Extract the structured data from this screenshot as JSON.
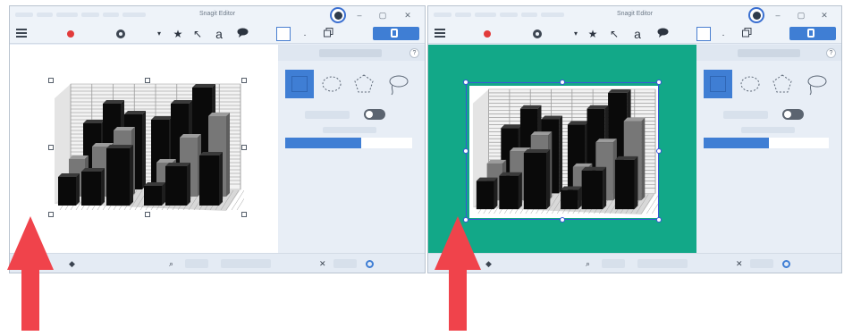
{
  "colors": {
    "accent": "#3f7ed4",
    "background_fill": "#12a888",
    "arrow": "#f0434b",
    "record": "#e23b3b"
  },
  "windows": [
    {
      "title": "Snagit Editor",
      "icons": {
        "menu": "hamburger-menu-icon",
        "record": "record-icon",
        "effects": "gear-icon",
        "dropdown": "chevron-down-icon",
        "favorite": "star-icon",
        "arrow_tool": "arrow-tool-icon",
        "text_tool": "text-tool-icon",
        "callout_tool": "callout-icon",
        "selection_tool": "selection-tool-icon",
        "copy": "copy-icon",
        "share": "share-icon"
      },
      "text_tool_glyph": "a",
      "window_controls": {
        "minimize": "–",
        "maximize": "▢",
        "close": "✕"
      },
      "props": {
        "help": "?"
      },
      "selection_shapes": [
        "rectangle",
        "ellipse",
        "polygon",
        "lasso"
      ],
      "fill_toggle": "off",
      "tolerance": 0.6
    },
    {
      "title": "Snagit Editor",
      "text_tool_glyph": "a",
      "window_controls": {
        "minimize": "–",
        "maximize": "▢",
        "close": "✕"
      },
      "props": {
        "help": "?"
      },
      "selection_shapes": [
        "rectangle",
        "ellipse",
        "polygon",
        "lasso"
      ],
      "fill_toggle": "off",
      "tolerance": 0.6
    }
  ]
}
